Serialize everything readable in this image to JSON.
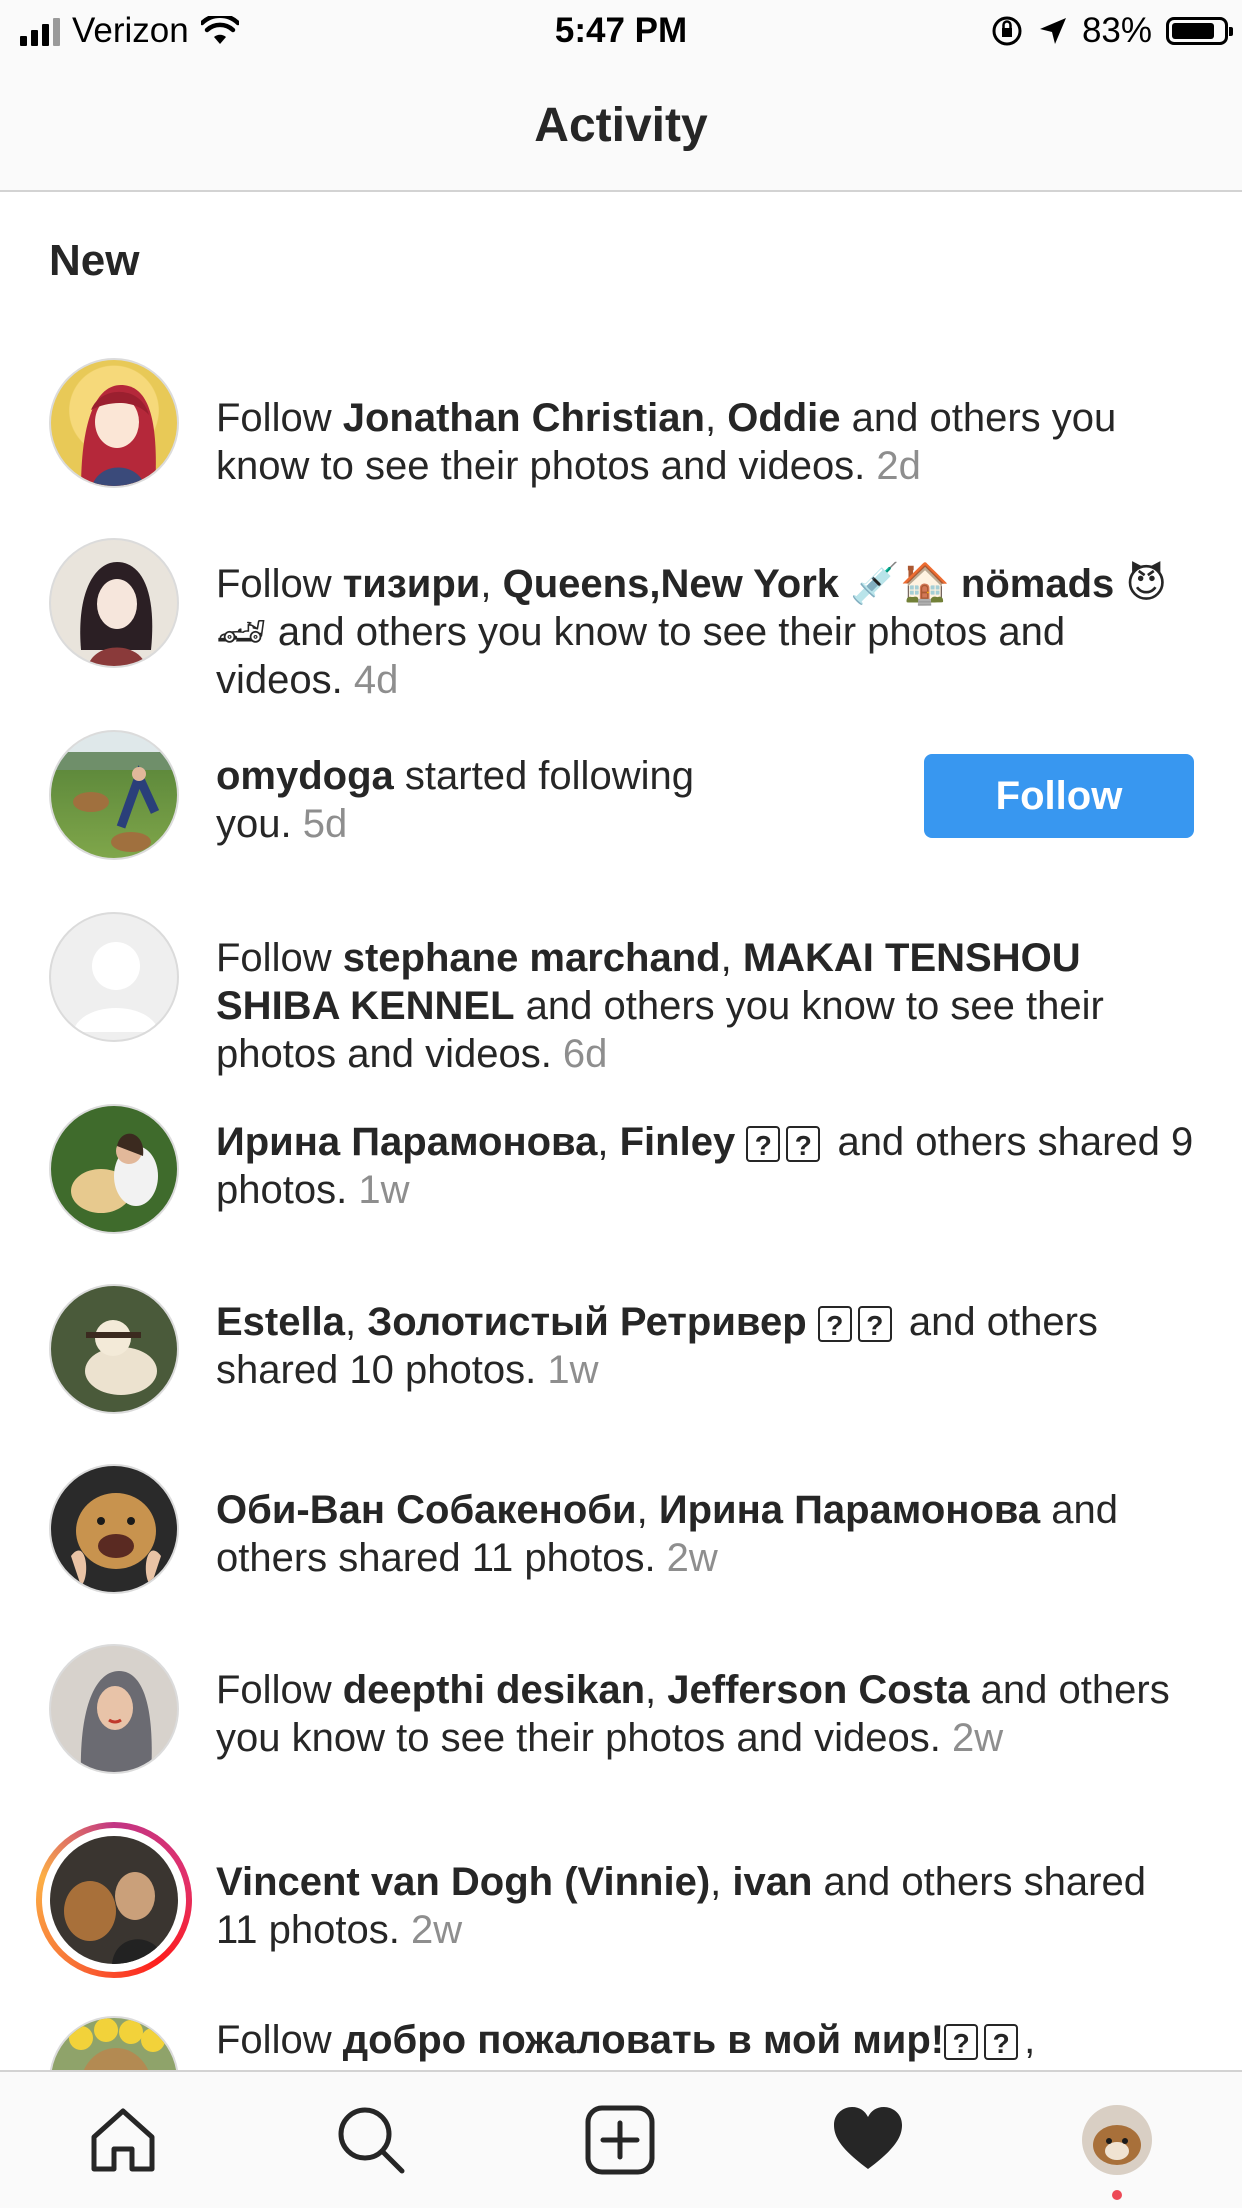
{
  "status_bar": {
    "carrier": "Verizon",
    "time": "5:47 PM",
    "battery": "83%",
    "battery_level": 0.83
  },
  "header": {
    "title": "Activity"
  },
  "section": {
    "title": "New"
  },
  "items": [
    {
      "pre": "Follow ",
      "b1": "Jonathan Christian",
      "sep1": ", ",
      "b2": "Oddie",
      "post": " and others you know to see their photos and videos. ",
      "time": "2d"
    },
    {
      "pre": "Follow ",
      "b1": "тизири",
      "sep1": ", ",
      "b2": "Queens,New York",
      "emoji1": "💉🏠",
      "b3": "nömads",
      "emoji2": "😈🏎",
      "post": " and others you know to see their photos and videos. ",
      "time": "4d"
    },
    {
      "b1": "omydoga",
      "post": " started following you. ",
      "time": "5d",
      "button": "Follow"
    },
    {
      "pre": "Follow ",
      "b1": "stephane marchand",
      "sep1": ", ",
      "b2": "MAKAI TENSHOU SHIBA KENNEL",
      "post": " and others you know to see their photos and videos. ",
      "time": "6d"
    },
    {
      "b1": "Ирина Парамонова",
      "sep1": ", ",
      "b2": "Finley",
      "box": "?",
      "post": " and others shared 9 photos. ",
      "time": "1w"
    },
    {
      "b1": "Estella",
      "sep1": ", ",
      "b2": "Золотистый Ретривер",
      "box": "?",
      "post": " and others shared 10 photos. ",
      "time": "1w"
    },
    {
      "b1": "Оби-Ван Собакеноби",
      "sep1": ", ",
      "b2": "Ирина Парамонова",
      "post": " and others shared 11 photos. ",
      "time": "2w"
    },
    {
      "pre": "Follow ",
      "b1": "deepthi desikan",
      "sep1": ", ",
      "b2": "Jefferson Costa",
      "post": " and others you know to see their photos and videos. ",
      "time": "2w"
    },
    {
      "b1": "Vincent van Dogh (Vinnie)",
      "sep1": ", ",
      "b2": "ivan",
      "post": " and others shared 11 photos. ",
      "time": "2w"
    },
    {
      "pre": "Follow ",
      "b1": "добро пожаловать в мой мир!",
      "box": "?",
      "post": ","
    }
  ],
  "tabs": [
    "home-icon",
    "search-icon",
    "add-post-icon",
    "heart-icon",
    "profile-avatar"
  ],
  "colors": {
    "accent": "#3897f0",
    "muted": "#8e8e8e",
    "text": "#262626",
    "notification_dot": "#ed4956"
  }
}
